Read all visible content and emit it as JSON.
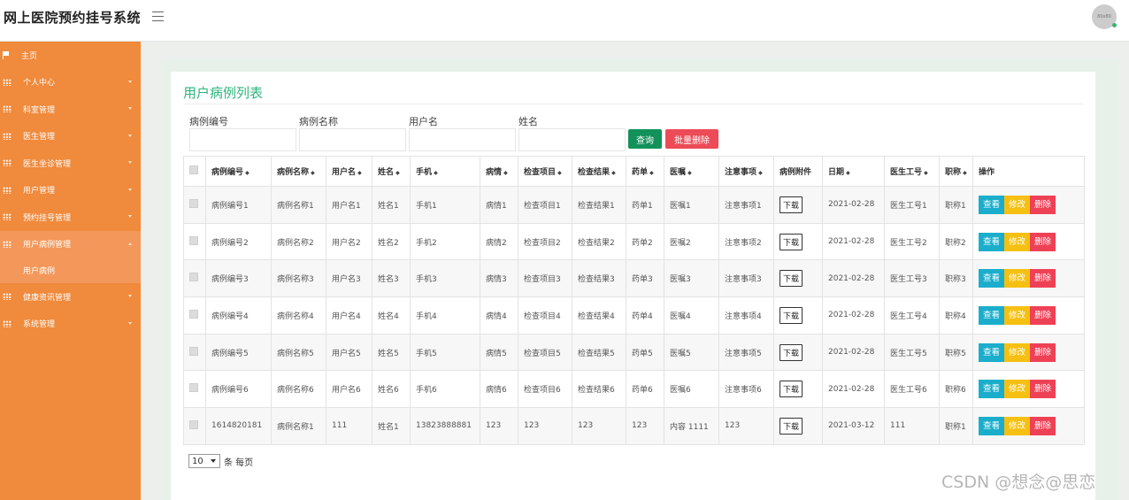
{
  "app": {
    "title": "网上医院预约挂号系统",
    "avatar_text": "80x80"
  },
  "sidebar": {
    "items": [
      {
        "label": "主页",
        "icon": "flag-icon",
        "has_caret": false
      },
      {
        "label": "个人中心",
        "icon": "grid-icon",
        "has_caret": true
      },
      {
        "label": "科室管理",
        "icon": "grid-icon",
        "has_caret": true
      },
      {
        "label": "医生管理",
        "icon": "grid-icon",
        "has_caret": true
      },
      {
        "label": "医生坐诊管理",
        "icon": "grid-icon",
        "has_caret": true
      },
      {
        "label": "用户管理",
        "icon": "grid-icon",
        "has_caret": true
      },
      {
        "label": "预约挂号管理",
        "icon": "grid-icon",
        "has_caret": true
      },
      {
        "label": "用户病例管理",
        "icon": "grid-icon",
        "has_caret": true,
        "open": true
      },
      {
        "label": "健康资讯管理",
        "icon": "grid-icon",
        "has_caret": true
      },
      {
        "label": "系统管理",
        "icon": "grid-icon",
        "has_caret": true
      }
    ],
    "sub_item": "用户病例"
  },
  "page": {
    "title": "用户病例列表",
    "filters": [
      {
        "label": "病例编号",
        "value": ""
      },
      {
        "label": "病例名称",
        "value": ""
      },
      {
        "label": "用户名",
        "value": ""
      },
      {
        "label": "姓名",
        "value": ""
      }
    ],
    "query_label": "查询",
    "batch_delete_label": "批量删除"
  },
  "table": {
    "columns": [
      "病例编号",
      "病例名称",
      "用户名",
      "姓名",
      "手机",
      "病情",
      "检查项目",
      "检查结果",
      "药单",
      "医嘱",
      "注意事项",
      "病例附件",
      "日期",
      "医生工号",
      "职称",
      "操作"
    ],
    "sortable": [
      true,
      true,
      true,
      true,
      true,
      true,
      true,
      true,
      true,
      true,
      true,
      false,
      true,
      true,
      true,
      false
    ],
    "attachment_label": "下载",
    "actions": {
      "view": "查看",
      "edit": "修改",
      "delete": "删除"
    },
    "rows": [
      [
        "病例编号1",
        "病例名称1",
        "用户名1",
        "姓名1",
        "手机1",
        "病情1",
        "检查项目1",
        "检查结果1",
        "药单1",
        "医嘱1",
        "注意事项1",
        "2021-02-28",
        "医生工号1",
        "职称1"
      ],
      [
        "病例编号2",
        "病例名称2",
        "用户名2",
        "姓名2",
        "手机2",
        "病情2",
        "检查项目2",
        "检查结果2",
        "药单2",
        "医嘱2",
        "注意事项2",
        "2021-02-28",
        "医生工号2",
        "职称2"
      ],
      [
        "病例编号3",
        "病例名称3",
        "用户名3",
        "姓名3",
        "手机3",
        "病情3",
        "检查项目3",
        "检查结果3",
        "药单3",
        "医嘱3",
        "注意事项3",
        "2021-02-28",
        "医生工号3",
        "职称3"
      ],
      [
        "病例编号4",
        "病例名称4",
        "用户名4",
        "姓名4",
        "手机4",
        "病情4",
        "检查项目4",
        "检查结果4",
        "药单4",
        "医嘱4",
        "注意事项4",
        "2021-02-28",
        "医生工号4",
        "职称4"
      ],
      [
        "病例编号5",
        "病例名称5",
        "用户名5",
        "姓名5",
        "手机5",
        "病情5",
        "检查项目5",
        "检查结果5",
        "药单5",
        "医嘱5",
        "注意事项5",
        "2021-02-28",
        "医生工号5",
        "职称5"
      ],
      [
        "病例编号6",
        "病例名称6",
        "用户名6",
        "姓名6",
        "手机6",
        "病情6",
        "检查项目6",
        "检查结果6",
        "药单6",
        "医嘱6",
        "注意事项6",
        "2021-02-28",
        "医生工号6",
        "职称6"
      ],
      [
        "1614820181",
        "病例名称1",
        "111",
        "姓名1",
        "13823888881",
        "123",
        "123",
        "123",
        "123",
        "内容 1111",
        "123",
        "2021-03-12",
        "111",
        "职称1"
      ]
    ]
  },
  "pager": {
    "page_size": "10",
    "suffix": "条 每页"
  },
  "watermark": "CSDN @想念@思恋",
  "colors": {
    "sidebar": "#f08a3c",
    "accent_green": "#2db67c",
    "query": "#12925a",
    "batch_delete": "#ec4b57",
    "view": "#1baecc",
    "edit": "#f5c012",
    "delete": "#ef4156"
  }
}
